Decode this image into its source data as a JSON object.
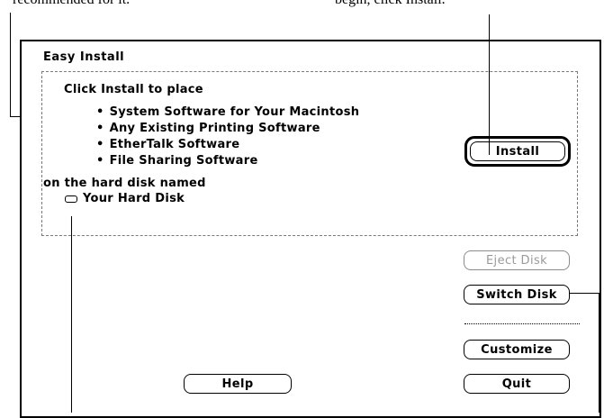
{
  "captions": {
    "left": "recommended for it.",
    "right": "begin, click Install."
  },
  "window": {
    "title": "Easy Install",
    "intro": "Click Install to place",
    "items": [
      "System Software for Your Macintosh",
      "Any Existing Printing Software",
      "EtherTalk Software",
      "File Sharing Software"
    ],
    "target_label": "on the hard disk named",
    "disk_name": "Your Hard Disk"
  },
  "buttons": {
    "install": "Install",
    "eject": "Eject Disk",
    "switch": "Switch Disk",
    "customize": "Customize",
    "help": "Help",
    "quit": "Quit"
  }
}
